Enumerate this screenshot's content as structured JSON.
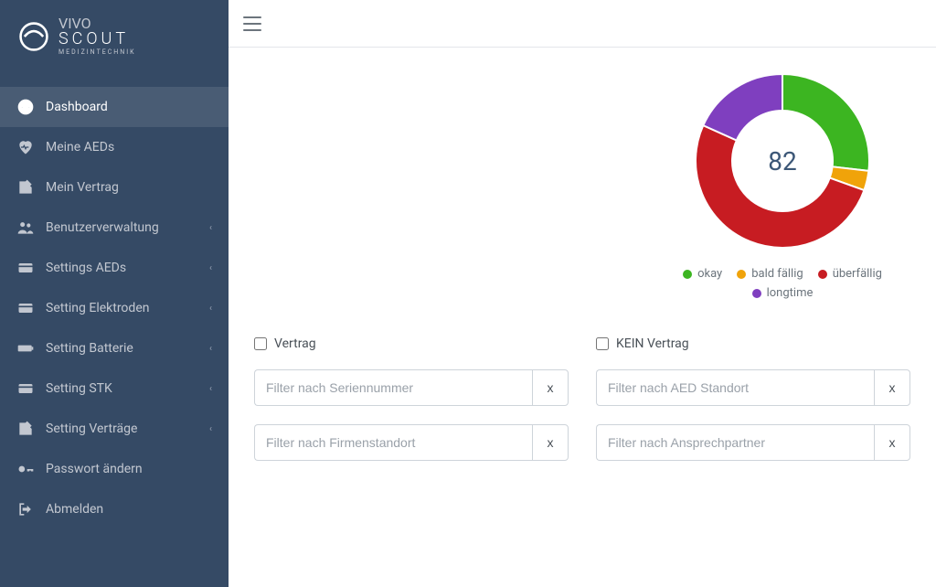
{
  "brand": {
    "title": "VIVO",
    "title2": "SCOUT",
    "subtitle": "MEDIZINTECHNIK"
  },
  "sidebar": {
    "items": [
      {
        "label": "Dashboard",
        "icon": "dashboard-icon",
        "active": true,
        "expandable": false
      },
      {
        "label": "Meine AEDs",
        "icon": "heart-icon",
        "active": false,
        "expandable": false
      },
      {
        "label": "Mein Vertrag",
        "icon": "document-edit-icon",
        "active": false,
        "expandable": false
      },
      {
        "label": "Benutzerverwaltung",
        "icon": "users-icon",
        "active": false,
        "expandable": true
      },
      {
        "label": "Settings AEDs",
        "icon": "card-icon",
        "active": false,
        "expandable": true
      },
      {
        "label": "Setting Elektroden",
        "icon": "card-icon",
        "active": false,
        "expandable": true
      },
      {
        "label": "Setting Batterie",
        "icon": "battery-icon",
        "active": false,
        "expandable": true
      },
      {
        "label": "Setting STK",
        "icon": "card-icon",
        "active": false,
        "expandable": true
      },
      {
        "label": "Setting Verträge",
        "icon": "document-edit-icon",
        "active": false,
        "expandable": true
      },
      {
        "label": "Passwort ändern",
        "icon": "key-icon",
        "active": false,
        "expandable": false
      },
      {
        "label": "Abmelden",
        "icon": "logout-icon",
        "active": false,
        "expandable": false
      }
    ]
  },
  "colors": {
    "okay": "#3cb521",
    "bald_faellig": "#f0a30a",
    "ueberfaellig": "#c71c22",
    "longtime": "#7f3fbf"
  },
  "chart_data": {
    "type": "pie",
    "title": "",
    "center_value": 82,
    "series": [
      {
        "name": "okay",
        "value": 22,
        "color": "#3cb521"
      },
      {
        "name": "bald fällig",
        "value": 3,
        "color": "#f0a30a"
      },
      {
        "name": "überfällig",
        "value": 42,
        "color": "#c71c22"
      },
      {
        "name": "longtime",
        "value": 15,
        "color": "#7f3fbf"
      }
    ],
    "total": 82,
    "legend_position": "bottom"
  },
  "legend": {
    "items": [
      {
        "label": "okay",
        "color": "#3cb521"
      },
      {
        "label": "bald fällig",
        "color": "#f0a30a"
      },
      {
        "label": "überfällig",
        "color": "#c71c22"
      },
      {
        "label": "longtime",
        "color": "#7f3fbf"
      }
    ]
  },
  "filters": {
    "checkbox_vertrag": "Vertrag",
    "checkbox_kein_vertrag": "KEIN Vertrag",
    "seriennummer_placeholder": "Filter nach Seriennummer",
    "aed_standort_placeholder": "Filter nach AED Standort",
    "firmenstandort_placeholder": "Filter nach Firmenstandort",
    "ansprechpartner_placeholder": "Filter nach Ansprechpartner",
    "clear_label": "x"
  }
}
